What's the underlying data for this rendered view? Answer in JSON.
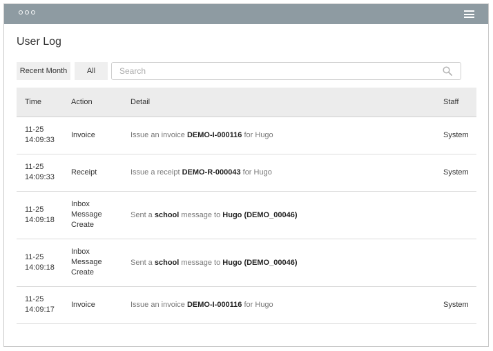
{
  "page_title": "User Log",
  "filters": {
    "recent_month": "Recent Month",
    "all": "All"
  },
  "search": {
    "placeholder": "Search"
  },
  "table": {
    "headers": {
      "time": "Time",
      "action": "Action",
      "detail": "Detail",
      "staff": "Staff"
    },
    "rows": [
      {
        "time": [
          "11-25",
          "14:09:33"
        ],
        "action": [
          "Invoice"
        ],
        "detail": [
          {
            "t": "Issue an invoice ",
            "b": false
          },
          {
            "t": "DEMO-I-000116",
            "b": true
          },
          {
            "t": " for Hugo",
            "b": false
          }
        ],
        "staff": "System"
      },
      {
        "time": [
          "11-25",
          "14:09:33"
        ],
        "action": [
          "Receipt"
        ],
        "detail": [
          {
            "t": "Issue a receipt ",
            "b": false
          },
          {
            "t": "DEMO-R-000043",
            "b": true
          },
          {
            "t": " for Hugo",
            "b": false
          }
        ],
        "staff": "System"
      },
      {
        "time": [
          "11-25",
          "14:09:18"
        ],
        "action": [
          "Inbox",
          "Message",
          "Create"
        ],
        "detail": [
          {
            "t": "Sent a ",
            "b": false
          },
          {
            "t": "school",
            "b": true
          },
          {
            "t": " message to ",
            "b": false
          },
          {
            "t": "Hugo (DEMO_00046)",
            "b": true
          }
        ],
        "staff": ""
      },
      {
        "time": [
          "11-25",
          "14:09:18"
        ],
        "action": [
          "Inbox",
          "Message",
          "Create"
        ],
        "detail": [
          {
            "t": "Sent a ",
            "b": false
          },
          {
            "t": "school",
            "b": true
          },
          {
            "t": " message to ",
            "b": false
          },
          {
            "t": "Hugo (DEMO_00046)",
            "b": true
          }
        ],
        "staff": ""
      },
      {
        "time": [
          "11-25",
          "14:09:17"
        ],
        "action": [
          "Invoice"
        ],
        "detail": [
          {
            "t": "Issue an invoice ",
            "b": false
          },
          {
            "t": "DEMO-I-000116",
            "b": true
          },
          {
            "t": " for Hugo",
            "b": false
          }
        ],
        "staff": "System"
      }
    ]
  }
}
